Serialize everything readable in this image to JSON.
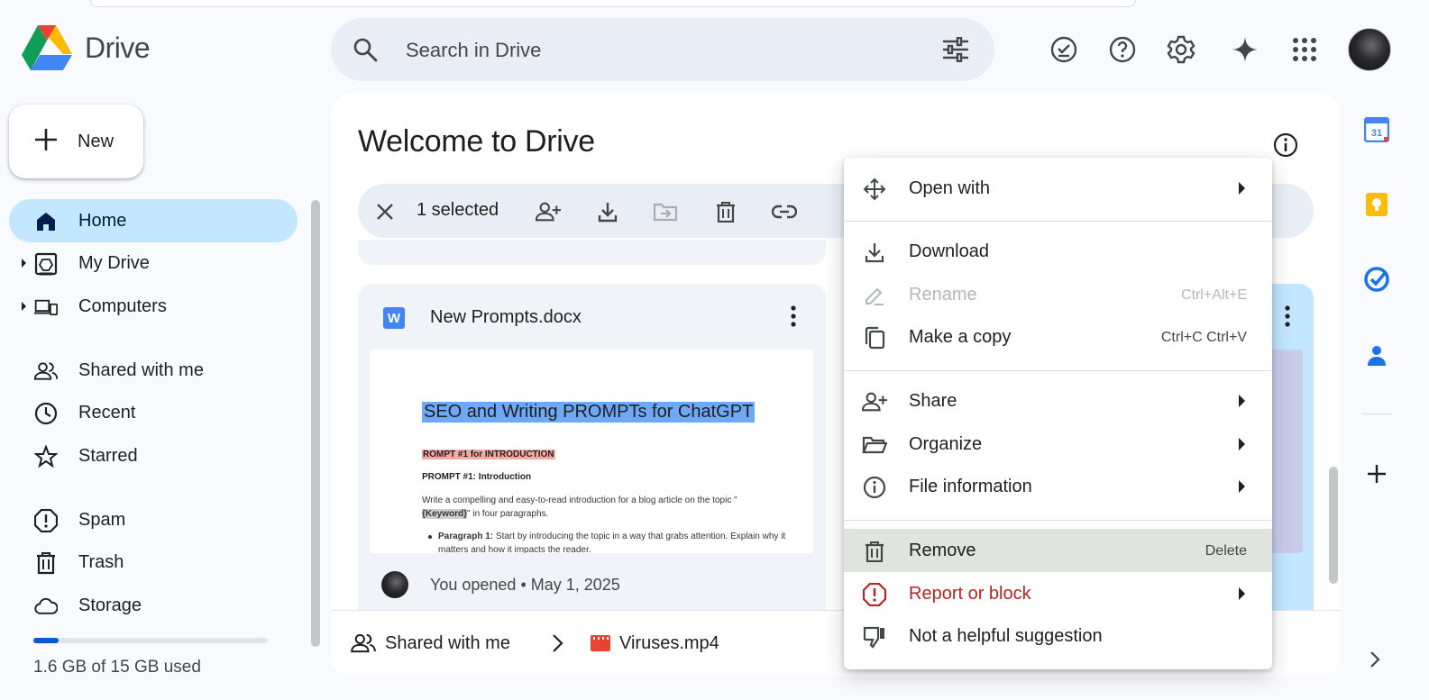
{
  "app": {
    "name": "Drive"
  },
  "search": {
    "placeholder": "Search in Drive"
  },
  "header_icons": [
    "offline-ready-icon",
    "help-icon",
    "settings-icon",
    "gemini-sparkle-icon",
    "apps-grid-icon"
  ],
  "new_button": {
    "label": "New"
  },
  "sidebar": {
    "items": [
      {
        "label": "Home",
        "icon": "home-icon",
        "active": true
      },
      {
        "label": "My Drive",
        "icon": "my-drive-icon"
      },
      {
        "label": "Computers",
        "icon": "computers-icon"
      },
      {
        "label": "Shared with me",
        "icon": "shared-icon"
      },
      {
        "label": "Recent",
        "icon": "clock-icon"
      },
      {
        "label": "Starred",
        "icon": "star-icon"
      },
      {
        "label": "Spam",
        "icon": "spam-icon"
      },
      {
        "label": "Trash",
        "icon": "trash-icon"
      },
      {
        "label": "Storage",
        "icon": "cloud-icon"
      }
    ]
  },
  "storage": {
    "text": "1.6 GB of 15 GB used",
    "used_fraction": 0.107
  },
  "main": {
    "title": "Welcome to Drive",
    "selection": {
      "count_label": "1 selected"
    },
    "file_card": {
      "name": "New Prompts.docx",
      "type_letter": "W",
      "meta": "You opened • May 1, 2025",
      "preview": {
        "title": "SEO and Writing PROMPTs for ChatGPT",
        "subtitle": "ROMPT #1 for INTRODUCTION",
        "heading": "PROMPT #1: Introduction",
        "para_a": "Write a compelling and easy-to-read introduction for a blog article on the topic \"",
        "para_keyword": "{Keyword}",
        "para_b": "\" in four paragraphs.",
        "bullet_bold": "Paragraph 1:",
        "bullet_text": " Start by introducing the topic in a way that grabs attention. Explain why it matters and how it impacts the reader."
      }
    },
    "footer": {
      "shared_label": "Shared with me",
      "file_label": "Viruses.mp4"
    }
  },
  "context_menu": {
    "items": [
      {
        "label": "Open with",
        "icon": "open-with-icon",
        "submenu": true
      },
      {
        "label": "Download",
        "icon": "download-icon"
      },
      {
        "label": "Rename",
        "icon": "rename-icon",
        "shortcut": "Ctrl+Alt+E",
        "disabled": true
      },
      {
        "label": "Make a copy",
        "icon": "copy-icon",
        "shortcut": "Ctrl+C Ctrl+V"
      },
      {
        "label": "Share",
        "icon": "share-icon",
        "submenu": true
      },
      {
        "label": "Organize",
        "icon": "organize-icon",
        "submenu": true
      },
      {
        "label": "File information",
        "icon": "info-icon",
        "submenu": true
      },
      {
        "label": "Remove",
        "icon": "trash-icon",
        "shortcut": "Delete",
        "highlighted": true
      },
      {
        "label": "Report or block",
        "icon": "report-icon",
        "submenu": true,
        "color": "#b3261e"
      },
      {
        "label": "Not a helpful suggestion",
        "icon": "thumbs-down-icon"
      }
    ]
  },
  "side_panel": [
    "calendar-icon",
    "keep-icon",
    "tasks-icon",
    "contacts-icon",
    "add-icon"
  ],
  "calendar_day": "31"
}
